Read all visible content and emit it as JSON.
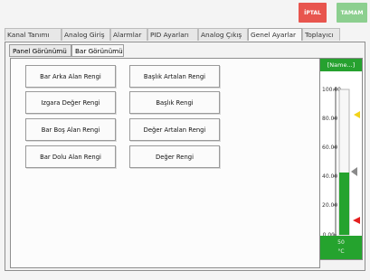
{
  "top_buttons": {
    "cancel": "İPTAL",
    "ok": "TAMAM",
    "cancel_color": "#e8554e",
    "ok_color": "#8ccf8f"
  },
  "tabs": [
    {
      "label": "Kanal Tanımı"
    },
    {
      "label": "Analog Giriş"
    },
    {
      "label": "Alarmlar"
    },
    {
      "label": "PID Ayarları"
    },
    {
      "label": "Analog Çıkış"
    },
    {
      "label": "Genel Ayarlar"
    },
    {
      "label": "Toplayıcı"
    }
  ],
  "subtabs": [
    {
      "label": "Panel Görünümü"
    },
    {
      "label": "Bar Görünümü"
    }
  ],
  "color_buttons": {
    "left": [
      "Bar Arka Alan Rengi",
      "Izgara Değer Rengi",
      "Bar Boş Alan Rengi",
      "Bar Dolu Alan Rengi"
    ],
    "right": [
      "Başlık Artalan Rengi",
      "Başlık Rengi",
      "Değer Artalan Rengi",
      "Değer Rengi"
    ]
  },
  "preview": {
    "title": "[Name...]",
    "ticks": [
      "100.00",
      "80.00",
      "60.00",
      "40.00",
      "20.00",
      "0.00"
    ],
    "value": "50",
    "unit": "°C",
    "fill_percent": 43,
    "title_color": "#26a12f",
    "fill_color": "#25a32e"
  }
}
